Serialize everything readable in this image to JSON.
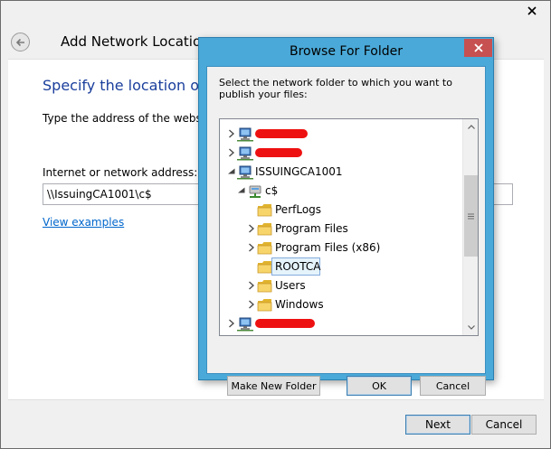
{
  "wizard": {
    "title": "Add Network Location",
    "heading": "Specify the location of yo",
    "description": "Type the address of the website,",
    "address_label": "Internet or network address:",
    "address_value": "\\\\IssuingCA1001\\c$",
    "view_examples_link": "View examples",
    "next_label": "Next",
    "cancel_label": "Cancel"
  },
  "dialog": {
    "title": "Browse For Folder",
    "instruction": "Select the network folder to which you want to publish your files:",
    "tree": [
      {
        "label": "",
        "type": "computer",
        "expander": "collapsed",
        "redacted": true,
        "indent": 0
      },
      {
        "label": "",
        "type": "computer",
        "expander": "collapsed",
        "redacted": true,
        "indent": 0
      },
      {
        "label": "ISSUINGCA1001",
        "type": "computer",
        "expander": "expanded",
        "redacted": false,
        "indent": 0
      },
      {
        "label": "c$",
        "type": "share",
        "expander": "expanded",
        "redacted": false,
        "indent": 1
      },
      {
        "label": "PerfLogs",
        "type": "folder",
        "expander": "none",
        "redacted": false,
        "indent": 2
      },
      {
        "label": "Program Files",
        "type": "folder",
        "expander": "collapsed",
        "redacted": false,
        "indent": 2
      },
      {
        "label": "Program Files (x86)",
        "type": "folder",
        "expander": "collapsed",
        "redacted": false,
        "indent": 2
      },
      {
        "label": "ROOTCA",
        "type": "folder",
        "expander": "none",
        "redacted": false,
        "indent": 2,
        "selected": true
      },
      {
        "label": "Users",
        "type": "folder",
        "expander": "collapsed",
        "redacted": false,
        "indent": 2
      },
      {
        "label": "Windows",
        "type": "folder",
        "expander": "collapsed",
        "redacted": false,
        "indent": 2
      },
      {
        "label": "",
        "type": "computer",
        "expander": "collapsed",
        "redacted": true,
        "indent": 0
      },
      {
        "label": "",
        "type": "computer",
        "expander": "collapsed",
        "redacted": true,
        "indent": 0
      }
    ],
    "make_new_folder_label": "Make New Folder",
    "ok_label": "OK",
    "cancel_label": "Cancel"
  },
  "colors": {
    "dialog_frame": "#4aa9d8",
    "close_button": "#c75050",
    "heading_blue": "#1a3e9c",
    "link_blue": "#0066cc",
    "redaction": "#ee1111",
    "selection_bg": "#e5f3fb",
    "selection_border": "#84acdd"
  },
  "icons": {
    "wizard_close": "close-icon",
    "back": "back-arrow-icon",
    "dialog_close": "close-icon",
    "computer": "computer-icon",
    "share": "network-share-icon",
    "folder": "folder-icon",
    "expand_collapsed": "chevron-right-icon",
    "expand_expanded": "chevron-down-icon",
    "scroll_up": "scroll-up-icon",
    "scroll_down": "scroll-down-icon",
    "scroll_grip": "grip-icon"
  }
}
